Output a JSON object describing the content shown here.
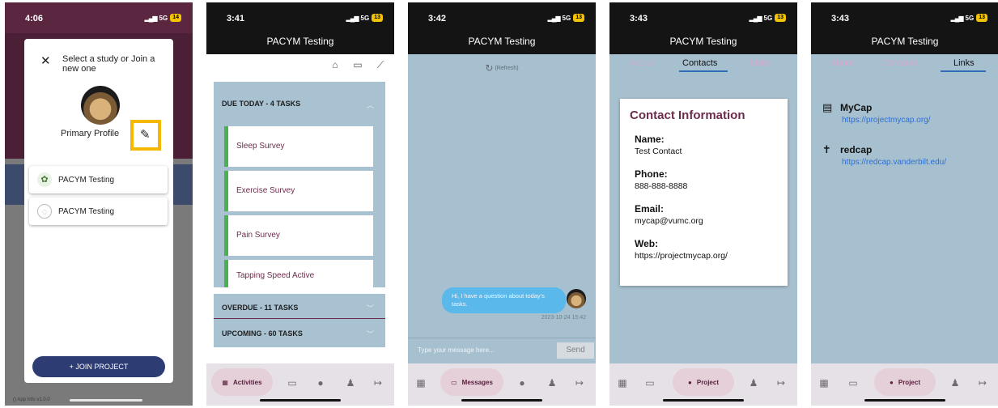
{
  "phone1": {
    "time": "4:06",
    "network": "5G",
    "battery": "14",
    "dialog": {
      "close_icon": "close-icon",
      "title": "Select a study or Join a new one",
      "profile_name": "Primary Profile",
      "edit_icon": "pencil-icon",
      "studies": [
        {
          "name": "PACYM Testing"
        },
        {
          "name": "PACYM Testing"
        }
      ],
      "join_label": "+ JOIN PROJECT"
    },
    "version": "() App Info v1.0.0"
  },
  "phone2": {
    "time": "3:41",
    "network": "5G",
    "battery": "13",
    "title": "PACYM Testing",
    "due_today": "DUE TODAY - 4 TASKS",
    "tasks": [
      "Sleep Survey",
      "Exercise Survey",
      "Pain Survey",
      "Tapping Speed Active"
    ],
    "overdue": "OVERDUE - 11 TASKS",
    "upcoming": "UPCOMING - 60 TASKS",
    "nav_active": "Activities"
  },
  "phone3": {
    "time": "3:42",
    "network": "5G",
    "battery": "13",
    "title": "PACYM Testing",
    "refresh": "(Refresh)",
    "message": "Hi, I have a question about today's tasks.",
    "timestamp": "2023-10-24 15:42",
    "input_placeholder": "Type your message here...",
    "send": "Send",
    "nav_active": "Messages"
  },
  "phone4": {
    "time": "3:43",
    "network": "5G",
    "battery": "13",
    "title": "PACYM Testing",
    "tabs": [
      "About",
      "Contacts",
      "Links"
    ],
    "contact": {
      "heading": "Contact Information",
      "name_label": "Name:",
      "name": "Test Contact",
      "phone_label": "Phone:",
      "phone": "888-888-8888",
      "email_label": "Email:",
      "email": "mycap@vumc.org",
      "web_label": "Web:",
      "web": "https://projectmycap.org/"
    },
    "nav_active": "Project"
  },
  "phone5": {
    "time": "3:43",
    "network": "5G",
    "battery": "13",
    "title": "PACYM Testing",
    "tabs": [
      "About",
      "Contacts",
      "Links"
    ],
    "links": [
      {
        "name": "MyCap",
        "url": "https://projectmycap.org/"
      },
      {
        "name": "redcap",
        "url": "https://redcap.vanderbilt.edu/"
      }
    ],
    "nav_active": "Project"
  },
  "colors": {
    "accent": "#6d2b4c",
    "panel": "#a7c0cf",
    "pill": "#e5cfd9",
    "link": "#2b6fd6",
    "join": "#2d3d74"
  }
}
